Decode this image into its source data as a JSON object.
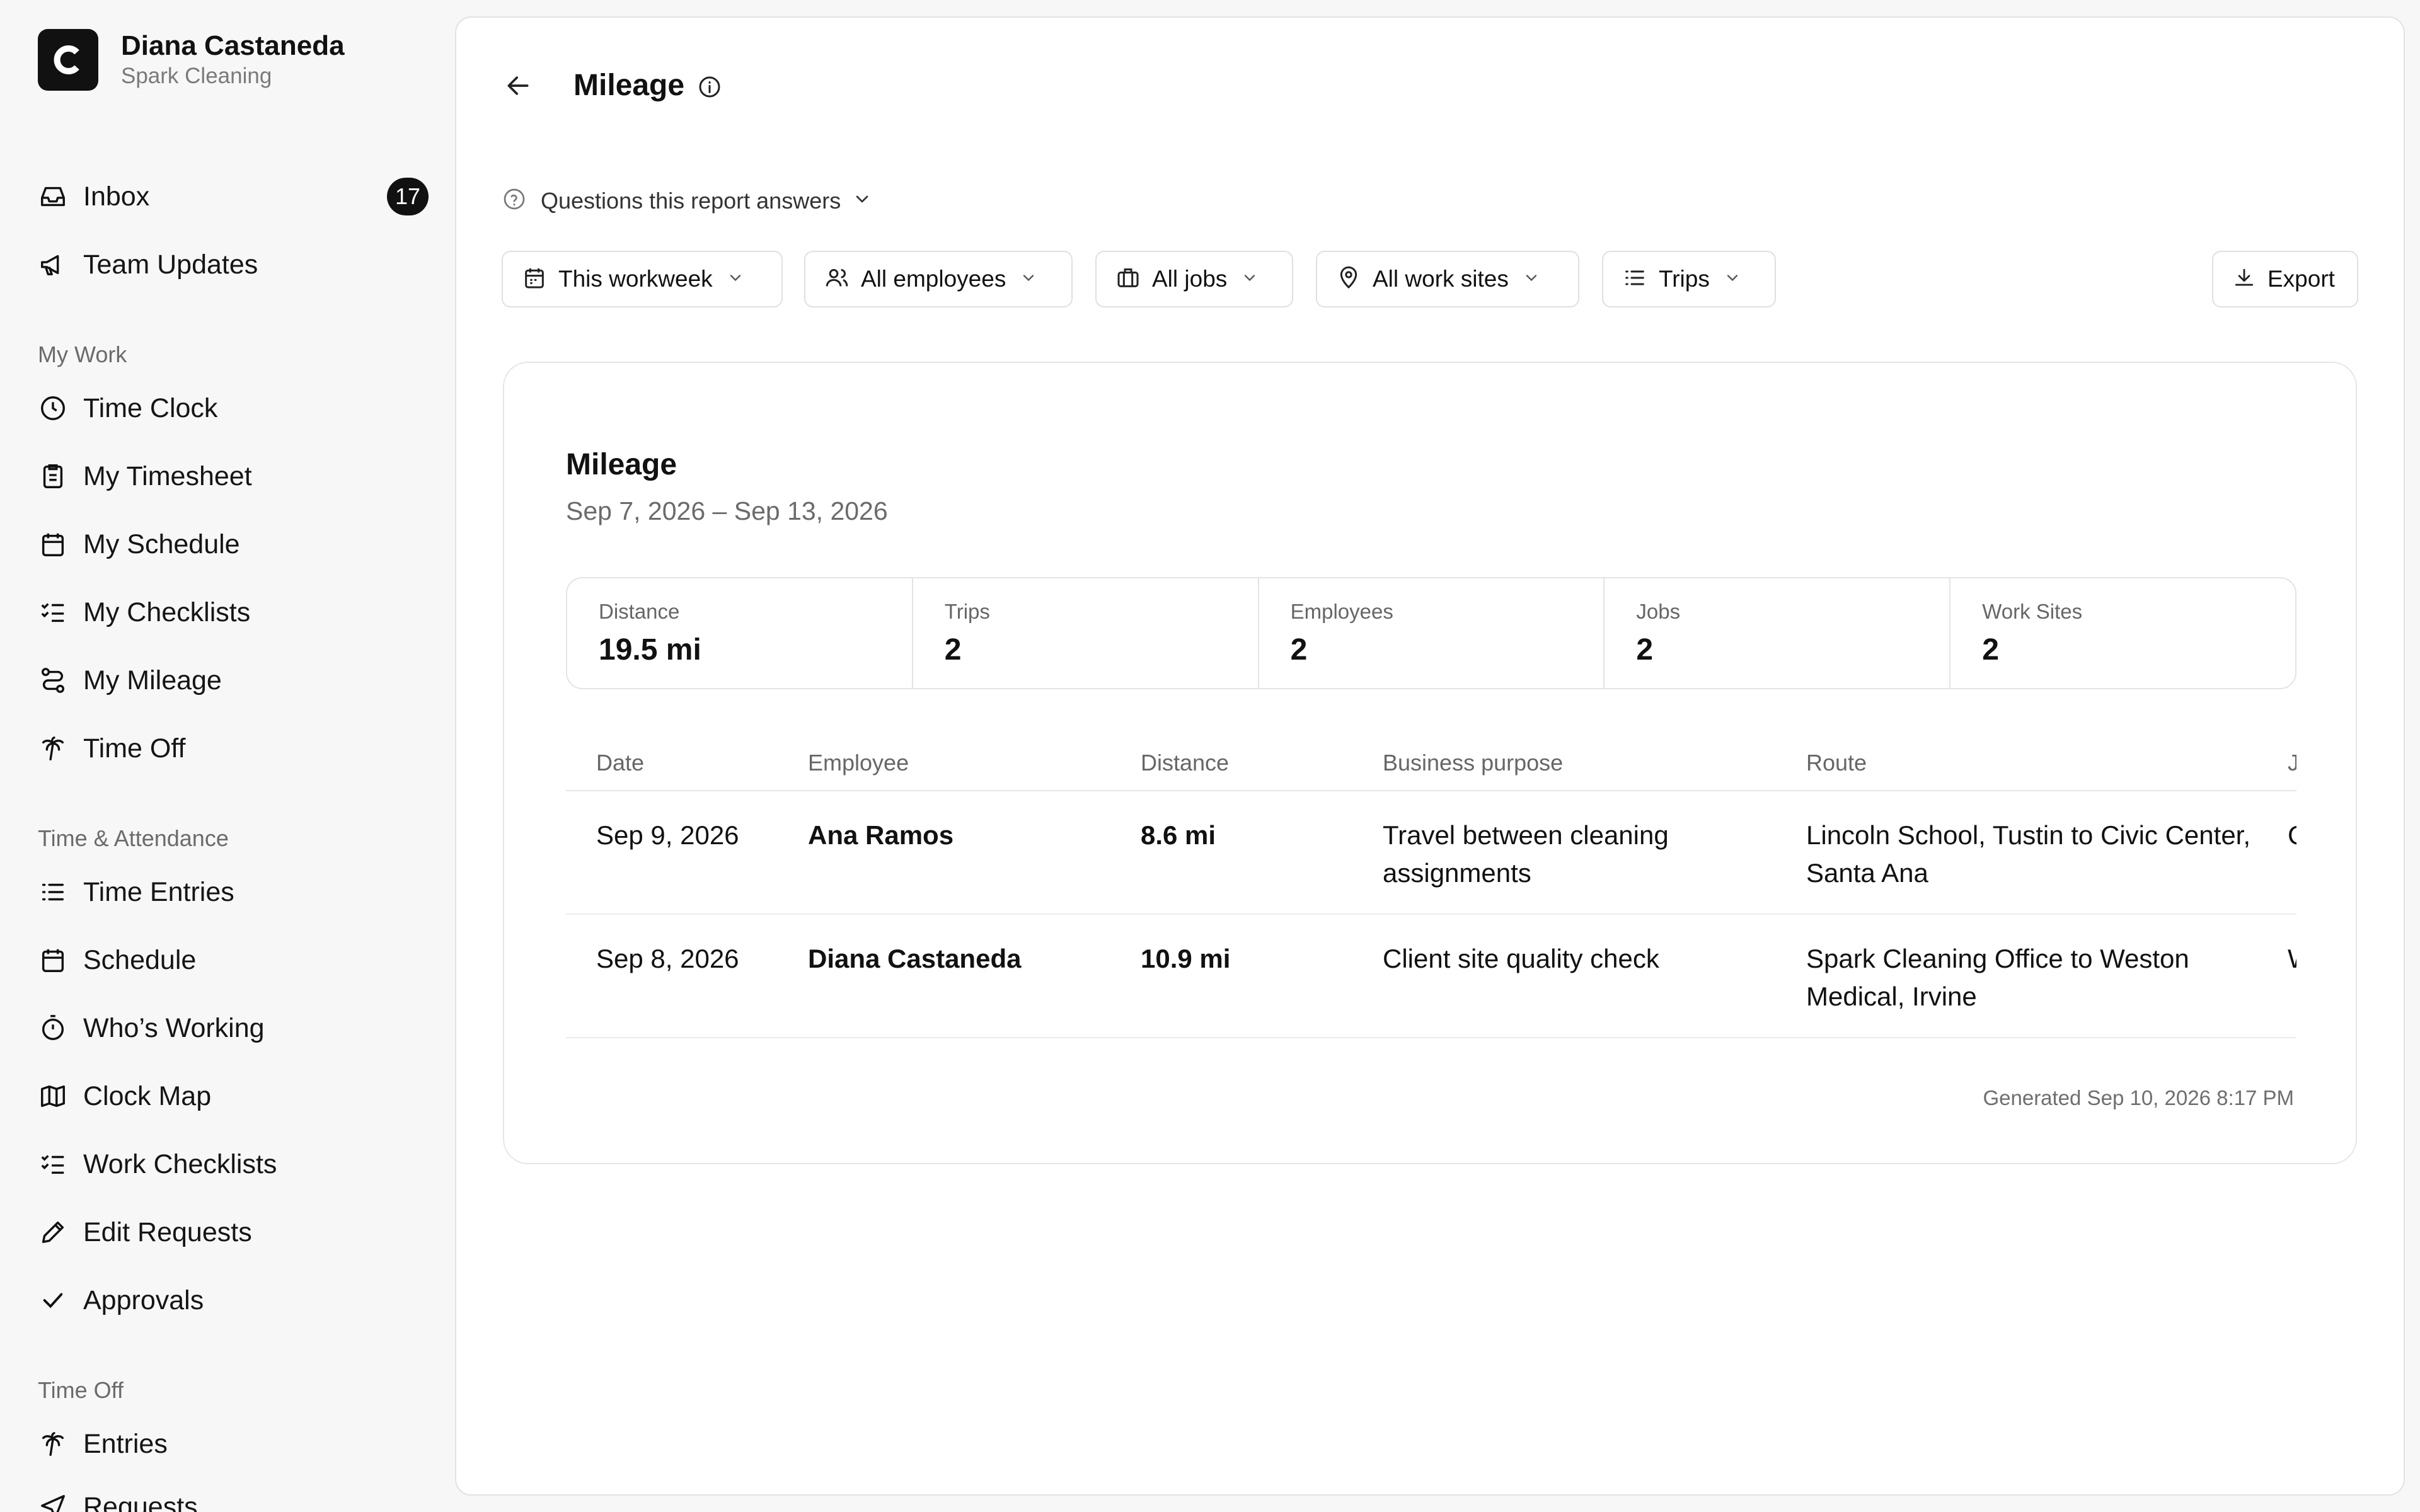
{
  "profile": {
    "name": "Diana Castaneda",
    "org": "Spark Cleaning"
  },
  "sidebar": {
    "top": [
      {
        "label": "Inbox",
        "badge": "17"
      },
      {
        "label": "Team Updates"
      }
    ],
    "my_work_title": "My Work",
    "my_work": [
      {
        "label": "Time Clock"
      },
      {
        "label": "My Timesheet"
      },
      {
        "label": "My Schedule"
      },
      {
        "label": "My Checklists"
      },
      {
        "label": "My Mileage"
      },
      {
        "label": "Time Off"
      }
    ],
    "attendance_title": "Time & Attendance",
    "attendance": [
      {
        "label": "Time Entries"
      },
      {
        "label": "Schedule"
      },
      {
        "label": "Who’s Working"
      },
      {
        "label": "Clock Map"
      },
      {
        "label": "Work Checklists"
      },
      {
        "label": "Edit Requests"
      },
      {
        "label": "Approvals"
      }
    ],
    "time_off_title": "Time Off",
    "time_off": [
      {
        "label": "Entries"
      },
      {
        "label": "Requests"
      }
    ]
  },
  "header": {
    "title": "Mileage"
  },
  "questions_label": "Questions this report answers",
  "filters": {
    "period": "This workweek",
    "employees": "All employees",
    "jobs": "All jobs",
    "sites": "All work sites",
    "group": "Trips",
    "export": "Export"
  },
  "report": {
    "title": "Mileage",
    "range": "Sep 7, 2026 – Sep 13, 2026",
    "stats": [
      {
        "label": "Distance",
        "value": "19.5 mi"
      },
      {
        "label": "Trips",
        "value": "2"
      },
      {
        "label": "Employees",
        "value": "2"
      },
      {
        "label": "Jobs",
        "value": "2"
      },
      {
        "label": "Work Sites",
        "value": "2"
      }
    ],
    "columns": [
      "Date",
      "Employee",
      "Distance",
      "Business purpose",
      "Route",
      "J"
    ],
    "rows": [
      {
        "date": "Sep 9, 2026",
        "employee": "Ana Ramos",
        "distance": "8.6 mi",
        "purpose": "Travel between cleaning assignments",
        "route": "Lincoln School, Tustin to Civic Center, Santa Ana",
        "extra": "C"
      },
      {
        "date": "Sep 8, 2026",
        "employee": "Diana Castaneda",
        "distance": "10.9 mi",
        "purpose": "Client site quality check",
        "route": "Spark Cleaning Office to Weston Medical, Irvine",
        "extra": "W"
      }
    ],
    "generated": "Generated Sep 10, 2026 8:17 PM"
  }
}
